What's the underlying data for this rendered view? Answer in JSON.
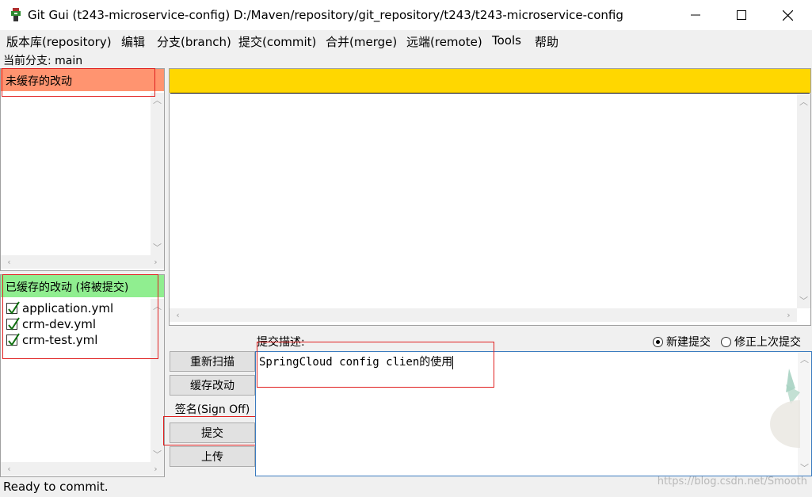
{
  "window": {
    "title": "Git Gui (t243-microservice-config) D:/Maven/repository/git_repository/t243/t243-microservice-config"
  },
  "menu": [
    "版本库(repository)",
    "编辑",
    "分支(branch)",
    "提交(commit)",
    "合并(merge)",
    "远端(remote)",
    "Tools",
    "帮助"
  ],
  "branch": {
    "label": "当前分支: main"
  },
  "unstaged": {
    "header": "未缓存的改动",
    "header_color": "#ff9470",
    "files": []
  },
  "staged": {
    "header": "已缓存的改动 (将被提交)",
    "header_color": "#90ee90",
    "files": [
      "application.yml",
      "crm-dev.yml",
      "crm-test.yml"
    ]
  },
  "diff": {
    "header_color": "#ffd700"
  },
  "buttons": {
    "rescan": "重新扫描",
    "stage": "缓存改动",
    "signoff": "签名(Sign Off)",
    "commit": "提交",
    "push": "上传"
  },
  "commit_message": {
    "label": "提交描述:",
    "text": "SpringCloud config clien的使用",
    "options": {
      "new": "新建提交",
      "amend": "修正上次提交",
      "selected": "new"
    }
  },
  "status": "Ready to commit.",
  "watermark": "https://blog.csdn.net/Smooth"
}
